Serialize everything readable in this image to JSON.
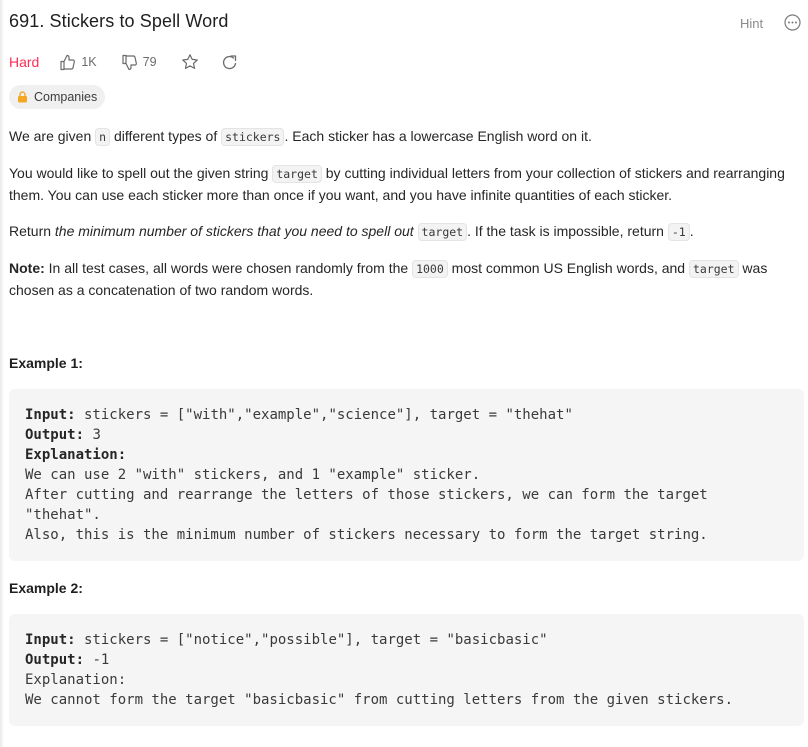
{
  "problem": {
    "title": "691. Stickers to Spell Word",
    "hint_label": "Hint",
    "difficulty": "Hard",
    "likes": "1K",
    "dislikes": "79",
    "companies_label": "Companies"
  },
  "description": {
    "p1": {
      "a": "We are given ",
      "code_n": "n",
      "b": " different types of ",
      "code_stickers": "stickers",
      "c": ". Each sticker has a lowercase English word on it."
    },
    "p2": {
      "a": "You would like to spell out the given string ",
      "code_target": "target",
      "b": " by cutting individual letters from your collection of stickers and rearranging them. You can use each sticker more than once if you want, and you have infinite quantities of each sticker."
    },
    "p3": {
      "a": "Return ",
      "em": "the minimum number of stickers that you need to spell out ",
      "code_target": "target",
      "b": ". If the task is impossible, return ",
      "code_neg": "-1",
      "c": "."
    },
    "p4": {
      "bold": "Note:",
      "a": " In all test cases, all words were chosen randomly from the ",
      "code_1000": "1000",
      "b": " most common US English words, and ",
      "code_target": "target",
      "c": " was chosen as a concatenation of two random words."
    }
  },
  "examples": [
    {
      "heading": "Example 1:",
      "input_key": "Input:",
      "input_val": " stickers = [\"with\",\"example\",\"science\"], target = \"thehat\"",
      "output_key": "Output:",
      "output_val": " 3",
      "explanation_key": "Explanation:",
      "explanation_lines": [
        "We can use 2 \"with\" stickers, and 1 \"example\" sticker.",
        "After cutting and rearrange the letters of those stickers, we can form the target",
        "\"thehat\".",
        "Also, this is the minimum number of stickers necessary to form the target string."
      ]
    },
    {
      "heading": "Example 2:",
      "input_key": "Input:",
      "input_val": " stickers = [\"notice\",\"possible\"], target = \"basicbasic\"",
      "output_key": "Output:",
      "output_val": " -1",
      "explanation_key": "Explanation:",
      "explanation_lines": [
        "We cannot form the target \"basicbasic\" from cutting letters from the given stickers."
      ]
    }
  ],
  "colors": {
    "difficulty_hard": "#ff2d55",
    "lock_orange": "#f5a623"
  },
  "icons": [
    "more-icon",
    "thumbs-up-icon",
    "thumbs-down-icon",
    "star-icon",
    "share-icon",
    "lock-icon"
  ]
}
